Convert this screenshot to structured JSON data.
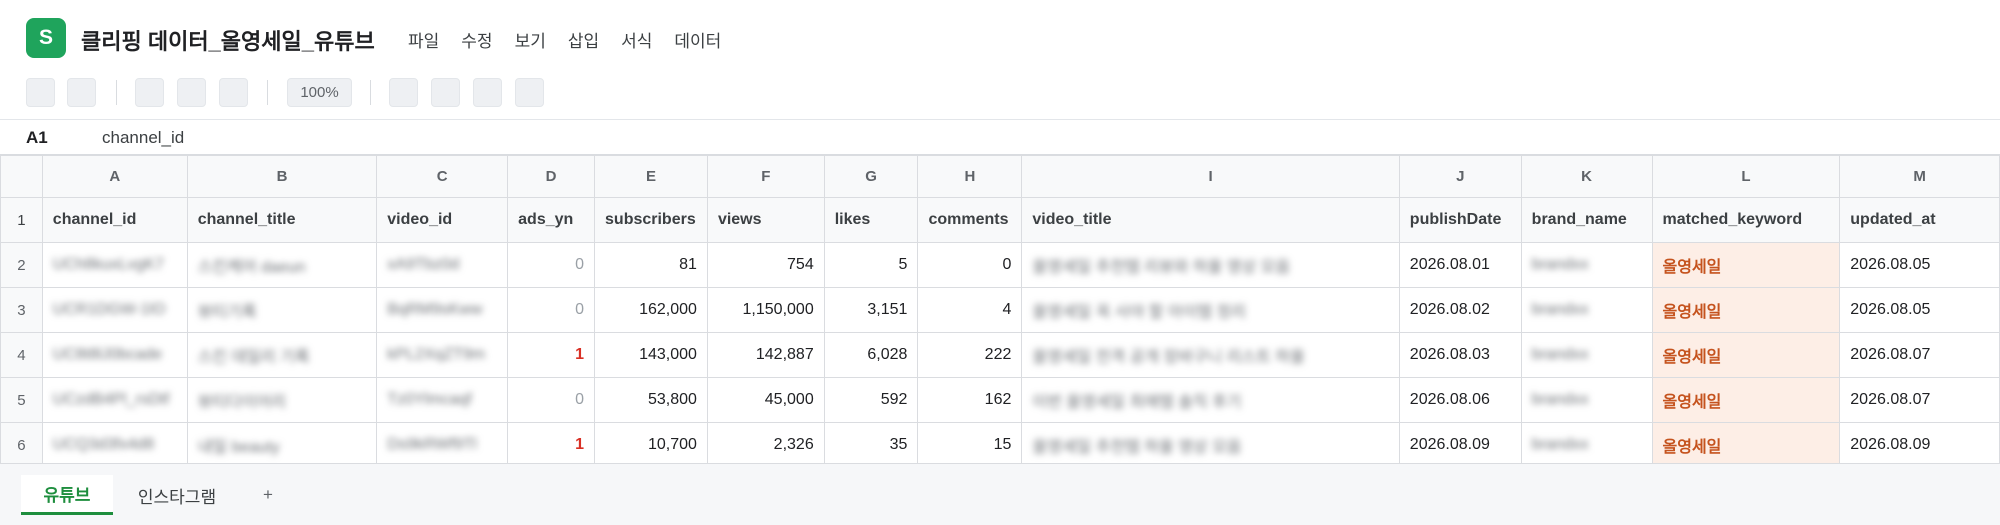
{
  "app": {
    "logo_letter": "S",
    "logo_color": "#1fa45c",
    "doc_title": "클리핑 데이터_올영세일_유튜브"
  },
  "menu": [
    "파일",
    "수정",
    "보기",
    "삽입",
    "서식",
    "데이터"
  ],
  "toolbar": {
    "zoom": "100%"
  },
  "formula_bar": {
    "cell_ref": "A1",
    "value": "channel_id"
  },
  "columns": [
    "A",
    "B",
    "C",
    "D",
    "E",
    "F",
    "G",
    "H",
    "I",
    "J",
    "K",
    "L",
    "M"
  ],
  "header_row": {
    "row_number": "1",
    "cells": [
      "channel_id",
      "channel_title",
      "video_id",
      "ads_yn",
      "subscribers",
      "views",
      "likes",
      "comments",
      "video_title",
      "publishDate",
      "brand_name",
      "matched_keyword",
      "updated_at"
    ]
  },
  "rows": [
    {
      "row_number": "2",
      "channel_id": "UCh8kuxLvgK7",
      "channel_title": "스킨케어 daeun",
      "video_id": "xA9Tbz0d",
      "ads_yn": "0",
      "subscribers": "81",
      "views": "754",
      "likes": "5",
      "comments": "0",
      "video_title": "올영세일 추천템 리뷰와 하울 영상 모음",
      "publishDate": "2026.08.01",
      "brand_name": "brandxx",
      "matched_keyword": "올영세일",
      "updated_at": "2026.08.05"
    },
    {
      "row_number": "3",
      "channel_id": "UCR1DGW-1lO",
      "channel_title": "뷰티기록",
      "video_id": "BqRM9sKww",
      "ads_yn": "0",
      "subscribers": "162,000",
      "views": "1,150,000",
      "likes": "3,151",
      "comments": "4",
      "video_title": "올영세일 꼭 사야 할 아이템 정리",
      "publishDate": "2026.08.02",
      "brand_name": "brandxx",
      "matched_keyword": "올영세일",
      "updated_at": "2026.08.05"
    },
    {
      "row_number": "4",
      "channel_id": "UC8t8lJ0bcade",
      "channel_title": "스킨 데일리 기록",
      "video_id": "kPL2XqZT9m",
      "ads_yn": "1",
      "subscribers": "143,000",
      "views": "142,887",
      "likes": "6,028",
      "comments": "222",
      "video_title": "올영세일 전격 공개 장바구니 리스트 하울",
      "publishDate": "2026.08.03",
      "brand_name": "brandxx",
      "matched_keyword": "올영세일",
      "updated_at": "2026.08.07"
    },
    {
      "row_number": "5",
      "channel_id": "UCzdB4Pl_rsDtf",
      "channel_title": "뷰티다이어리",
      "video_id": "Tz0Ylmcaqf",
      "ads_yn": "0",
      "subscribers": "53,800",
      "views": "45,000",
      "likes": "592",
      "comments": "162",
      "video_title": "이번 올영세일 최애템 솔직 후기",
      "publishDate": "2026.08.06",
      "brand_name": "brandxx",
      "matched_keyword": "올영세일",
      "updated_at": "2026.08.07"
    },
    {
      "row_number": "6",
      "channel_id": "UCQ3d3fx4d8",
      "channel_title": "내일 beauty",
      "video_id": "Ds9kRWf9Tl",
      "ads_yn": "1",
      "subscribers": "10,700",
      "views": "2,326",
      "likes": "35",
      "comments": "15",
      "video_title": "올영세일 추천템 하울 영상 모음",
      "publishDate": "2026.08.09",
      "brand_name": "brandxx",
      "matched_keyword": "올영세일",
      "updated_at": "2026.08.09"
    }
  ],
  "sheet_tabs": {
    "active": "유튜브",
    "inactive": "인스타그램",
    "add": "+"
  },
  "colors": {
    "accent_green": "#1e8e3e",
    "keyword_bg": "#fdeee6",
    "keyword_text": "#c5531e",
    "ads_one": "#d93025"
  }
}
